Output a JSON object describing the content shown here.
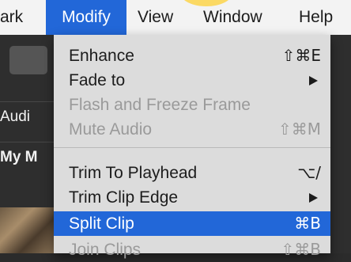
{
  "menubar": {
    "items": [
      {
        "label": "ark"
      },
      {
        "label": "Modify"
      },
      {
        "label": "View"
      },
      {
        "label": "Window"
      },
      {
        "label": "Help"
      }
    ]
  },
  "background": {
    "left_labels": [
      "Audi",
      "My M"
    ]
  },
  "menu": {
    "items": [
      {
        "label": "Enhance",
        "shortcut": "⇧⌘E"
      },
      {
        "label": "Fade to"
      },
      {
        "label": "Flash and Freeze Frame"
      },
      {
        "label": "Mute Audio",
        "shortcut": "⇧⌘M"
      },
      {
        "label": "Trim To Playhead",
        "shortcut": "⌥/"
      },
      {
        "label": "Trim Clip Edge"
      },
      {
        "label": "Split Clip",
        "shortcut": "⌘B"
      },
      {
        "label": "Join Clips",
        "shortcut": "⇧⌘B"
      }
    ]
  },
  "colors": {
    "highlight": "#2267d8",
    "menu_background": "#dcdcdc",
    "disabled_text": "#9a9a9a"
  }
}
